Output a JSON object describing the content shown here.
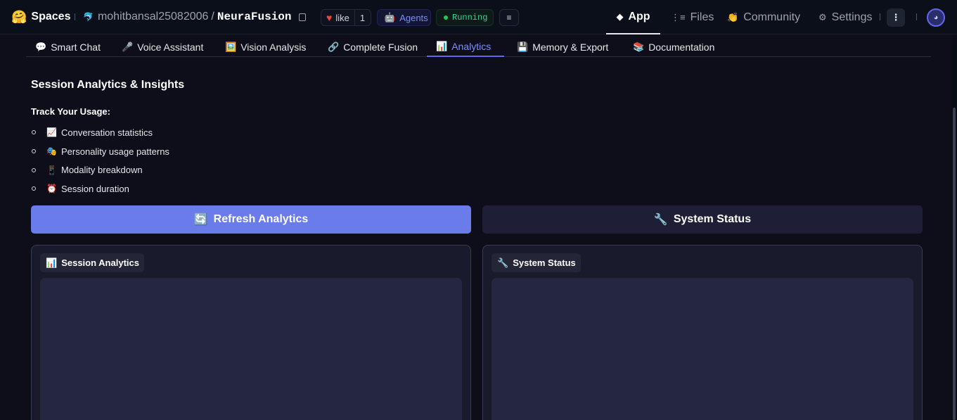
{
  "header": {
    "brand_emoji": "🤗",
    "brand_label": "Spaces",
    "owner_icon": "🐬",
    "owner": "mohitbansal25082006",
    "slash": "/",
    "space_name": "NeuraFusion",
    "like_label": "like",
    "like_count": "1",
    "agents_label": "Agents",
    "status_label": "Running",
    "nav": {
      "app": "App",
      "files": "Files",
      "community": "Community",
      "settings": "Settings"
    }
  },
  "tabs": [
    {
      "icon": "💬",
      "label": "Smart Chat"
    },
    {
      "icon": "🎤",
      "label": "Voice Assistant"
    },
    {
      "icon": "🖼️",
      "label": "Vision Analysis"
    },
    {
      "icon": "🔗",
      "label": "Complete Fusion"
    },
    {
      "icon": "📊",
      "label": "Analytics"
    },
    {
      "icon": "💾",
      "label": "Memory & Export"
    },
    {
      "icon": "📚",
      "label": "Documentation"
    }
  ],
  "active_tab": "Analytics",
  "content": {
    "heading": "Session Analytics & Insights",
    "subheading": "Track Your Usage:",
    "bullets": [
      {
        "icon": "📈",
        "text": "Conversation statistics"
      },
      {
        "icon": "🎭",
        "text": "Personality usage patterns"
      },
      {
        "icon": "📱",
        "text": "Modality breakdown"
      },
      {
        "icon": "⏰",
        "text": "Session duration"
      }
    ],
    "refresh_button": {
      "icon": "🔄",
      "label": "Refresh Analytics"
    },
    "status_button": {
      "icon": "🔧",
      "label": "System Status"
    },
    "panel_left": {
      "icon": "📊",
      "label": "Session Analytics"
    },
    "panel_right": {
      "icon": "🔧",
      "label": "System Status"
    }
  },
  "colors": {
    "accent": "#6a7bea",
    "background": "#0e0e1a",
    "running": "#22c55e",
    "like_heart": "#ef4444"
  }
}
